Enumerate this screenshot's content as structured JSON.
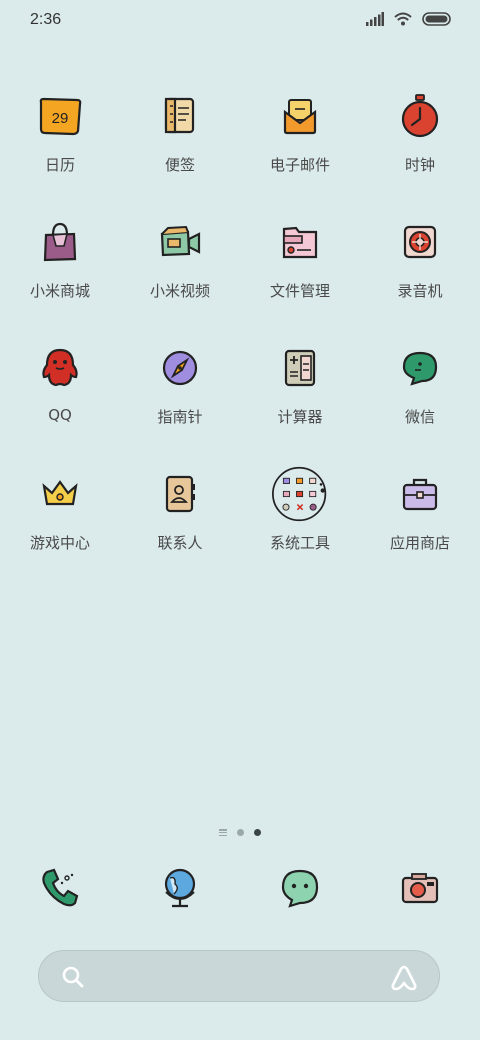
{
  "status_bar": {
    "time": "2:36"
  },
  "apps": [
    {
      "label": "日历",
      "icon": "calendar-icon",
      "date": "29"
    },
    {
      "label": "便签",
      "icon": "notes-icon"
    },
    {
      "label": "电子邮件",
      "icon": "email-icon"
    },
    {
      "label": "时钟",
      "icon": "clock-icon"
    },
    {
      "label": "小米商城",
      "icon": "shopping-bag-icon"
    },
    {
      "label": "小米视频",
      "icon": "video-camera-icon"
    },
    {
      "label": "文件管理",
      "icon": "folder-icon"
    },
    {
      "label": "录音机",
      "icon": "recorder-icon"
    },
    {
      "label": "QQ",
      "icon": "qq-penguin-icon"
    },
    {
      "label": "指南针",
      "icon": "compass-icon"
    },
    {
      "label": "计算器",
      "icon": "calculator-icon"
    },
    {
      "label": "微信",
      "icon": "wechat-bubble-icon"
    },
    {
      "label": "游戏中心",
      "icon": "crown-icon"
    },
    {
      "label": "联系人",
      "icon": "contacts-book-icon"
    },
    {
      "label": "系统工具",
      "icon": "folder-grid-icon"
    },
    {
      "label": "应用商店",
      "icon": "briefcase-icon"
    }
  ],
  "dock": [
    {
      "icon": "phone-icon"
    },
    {
      "icon": "browser-globe-icon"
    },
    {
      "icon": "messages-bubble-icon"
    },
    {
      "icon": "camera-icon"
    }
  ],
  "page_indicator": {
    "pages": 2,
    "current": 2
  },
  "search": {
    "placeholder": ""
  },
  "colors": {
    "background": "#dbeaeb",
    "calendar": "#f4a521",
    "clock": "#d9432f",
    "qq": "#d12f26",
    "wechat": "#2e9a6b",
    "compass": "#9f8de0",
    "store": "#cbbbe8"
  }
}
